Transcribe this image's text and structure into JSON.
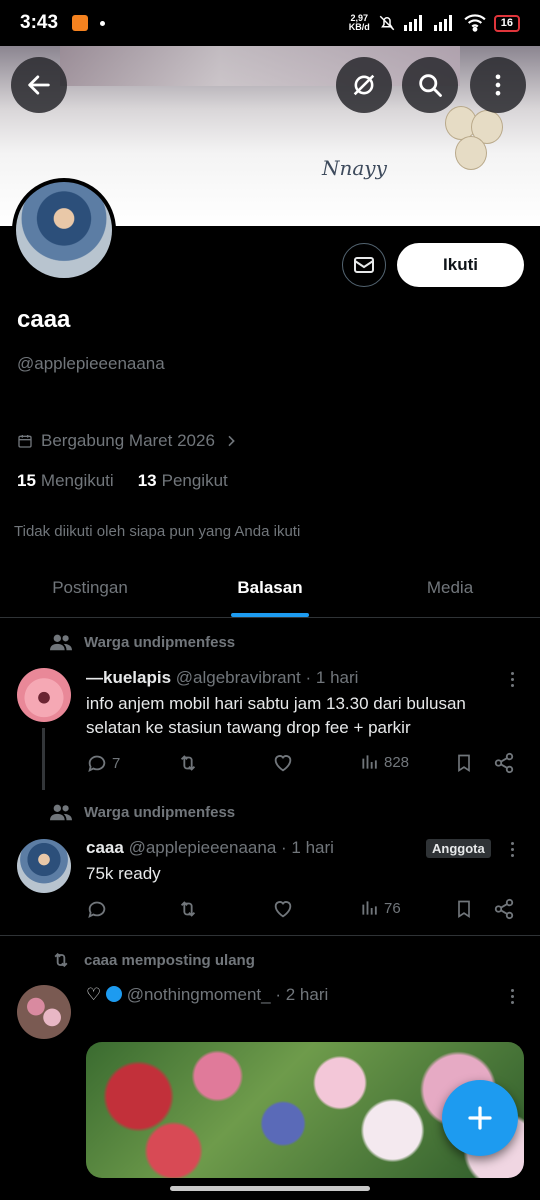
{
  "status_bar": {
    "time": "3:43",
    "net_speed_top": "2,97",
    "net_speed_unit": "KB/d",
    "battery": "16"
  },
  "banner": {
    "signature": "Nnayy"
  },
  "profile": {
    "name": "caaa",
    "handle": "@applepieeenaana",
    "joined": "Bergabung Maret 2026",
    "following_count": "15",
    "following_label": "Mengikuti",
    "followers_count": "13",
    "followers_label": "Pengikut",
    "not_followed": "Tidak diikuti oleh siapa pun yang Anda ikuti",
    "follow_button": "Ikuti"
  },
  "tabs": [
    "Postingan",
    "Balasan",
    "Media"
  ],
  "posts": [
    {
      "context": "Warga undipmenfess",
      "author": "—kuelapis",
      "handle": "@algebravibrant",
      "time": "· 1 hari",
      "text": "info anjem mobil hari sabtu jam 13.30 dari bulusan selatan ke stasiun tawang drop fee + parkir",
      "replies": "7",
      "views": "828"
    },
    {
      "context": "Warga undipmenfess",
      "author": "caaa",
      "handle": "@applepieeenaana",
      "time": "· 1 hari",
      "badge": "Anggota",
      "text": "75k ready",
      "views": "76"
    },
    {
      "context": "caaa memposting ulang",
      "author": "♡",
      "handle": "@nothingmoment_",
      "time": "· 2 hari"
    }
  ],
  "colors": {
    "accent": "#1d9bf0",
    "background": "#000000",
    "muted": "#71767b"
  }
}
